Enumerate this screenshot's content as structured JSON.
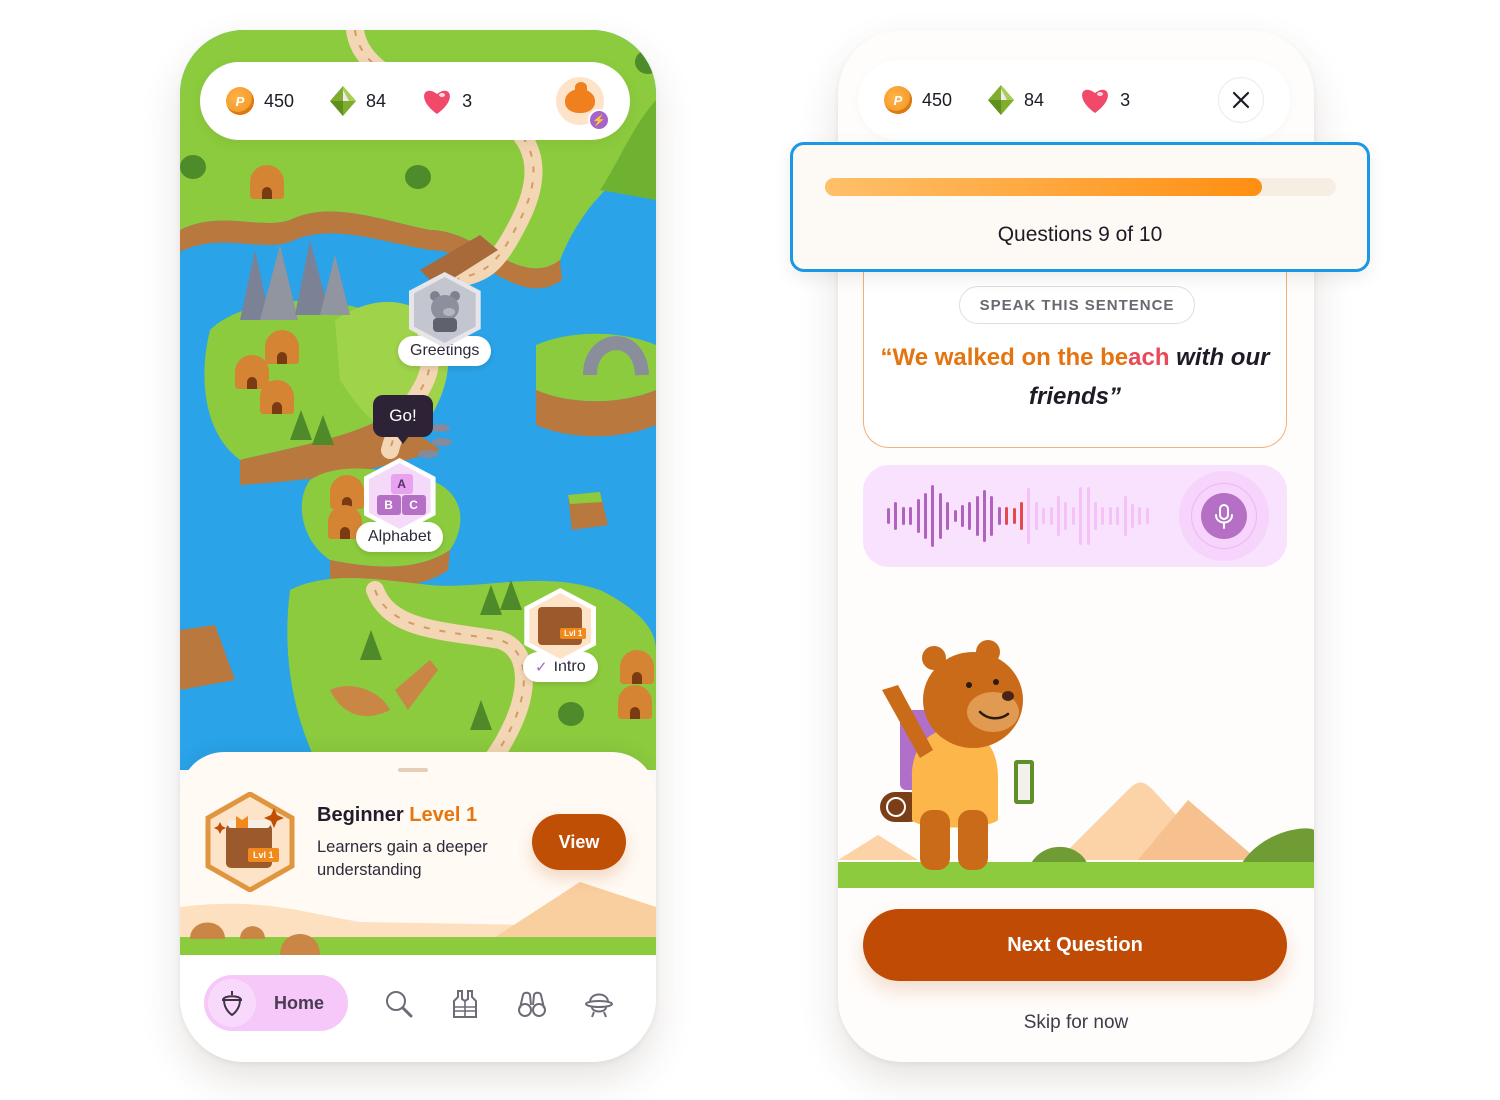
{
  "stats": {
    "coins": "450",
    "gems": "84",
    "hearts": "3"
  },
  "map_screen": {
    "nodes": [
      {
        "label": "Greetings",
        "state": "locked"
      },
      {
        "label": "Alphabet",
        "state": "current"
      },
      {
        "label": "Intro",
        "state": "completed"
      }
    ],
    "go_tooltip": "Go!",
    "intro_badge_tag": "Lvl 1",
    "alphabet_blocks": [
      "A",
      "B",
      "C"
    ],
    "level_card": {
      "title_prefix": "Beginner",
      "title_accent": "Level 1",
      "description": "Learners gain a deeper understanding",
      "badge_tag": "Lvl 1",
      "view_label": "View"
    },
    "nav": {
      "items": [
        {
          "label": "Home",
          "icon": "acorn-icon",
          "active": true
        },
        {
          "label": "",
          "icon": "search-icon",
          "active": false
        },
        {
          "label": "",
          "icon": "vest-icon",
          "active": false
        },
        {
          "label": "",
          "icon": "binoculars-icon",
          "active": false
        },
        {
          "label": "",
          "icon": "explorer-hat-icon",
          "active": false
        }
      ]
    }
  },
  "quiz_screen": {
    "close_icon": "close-icon",
    "progress": {
      "current": 9,
      "total": 10,
      "fraction": 0.855,
      "label": "Questions 9 of 10"
    },
    "prompt": "SPEAK THIS SENTENCE",
    "sentence": {
      "open_quote": "“",
      "spoken": "We walked on the be",
      "current": "ach",
      "remaining": " with our friends",
      "close_quote": "”"
    },
    "waveform": {
      "recorded_bars": [
        0.25,
        0.45,
        0.3,
        0.3,
        0.55,
        0.75,
        1.0,
        0.75,
        0.45,
        0.2,
        0.35,
        0.45,
        0.65,
        0.85,
        0.65,
        0.3
      ],
      "active_bars": [
        0.3,
        0.25,
        0.45
      ],
      "pending_bars": [
        0.9,
        0.45,
        0.25,
        0.3,
        0.65,
        0.45,
        0.3,
        0.95,
        0.95,
        0.45,
        0.3,
        0.3,
        0.3,
        0.65,
        0.4,
        0.3,
        0.25
      ],
      "colors": {
        "recorded": "#b062bf",
        "active": "#e5484d",
        "pending": "#f4c2f8"
      }
    },
    "mic_icon": "microphone-icon",
    "next_label": "Next Question",
    "skip_label": "Skip for now"
  },
  "colors": {
    "primary_button": "#bf4b05",
    "accent_orange": "#e47610",
    "highlight_border": "#1a98e6",
    "nav_active": "#f5c8f9",
    "mic": "#b56fc4"
  }
}
